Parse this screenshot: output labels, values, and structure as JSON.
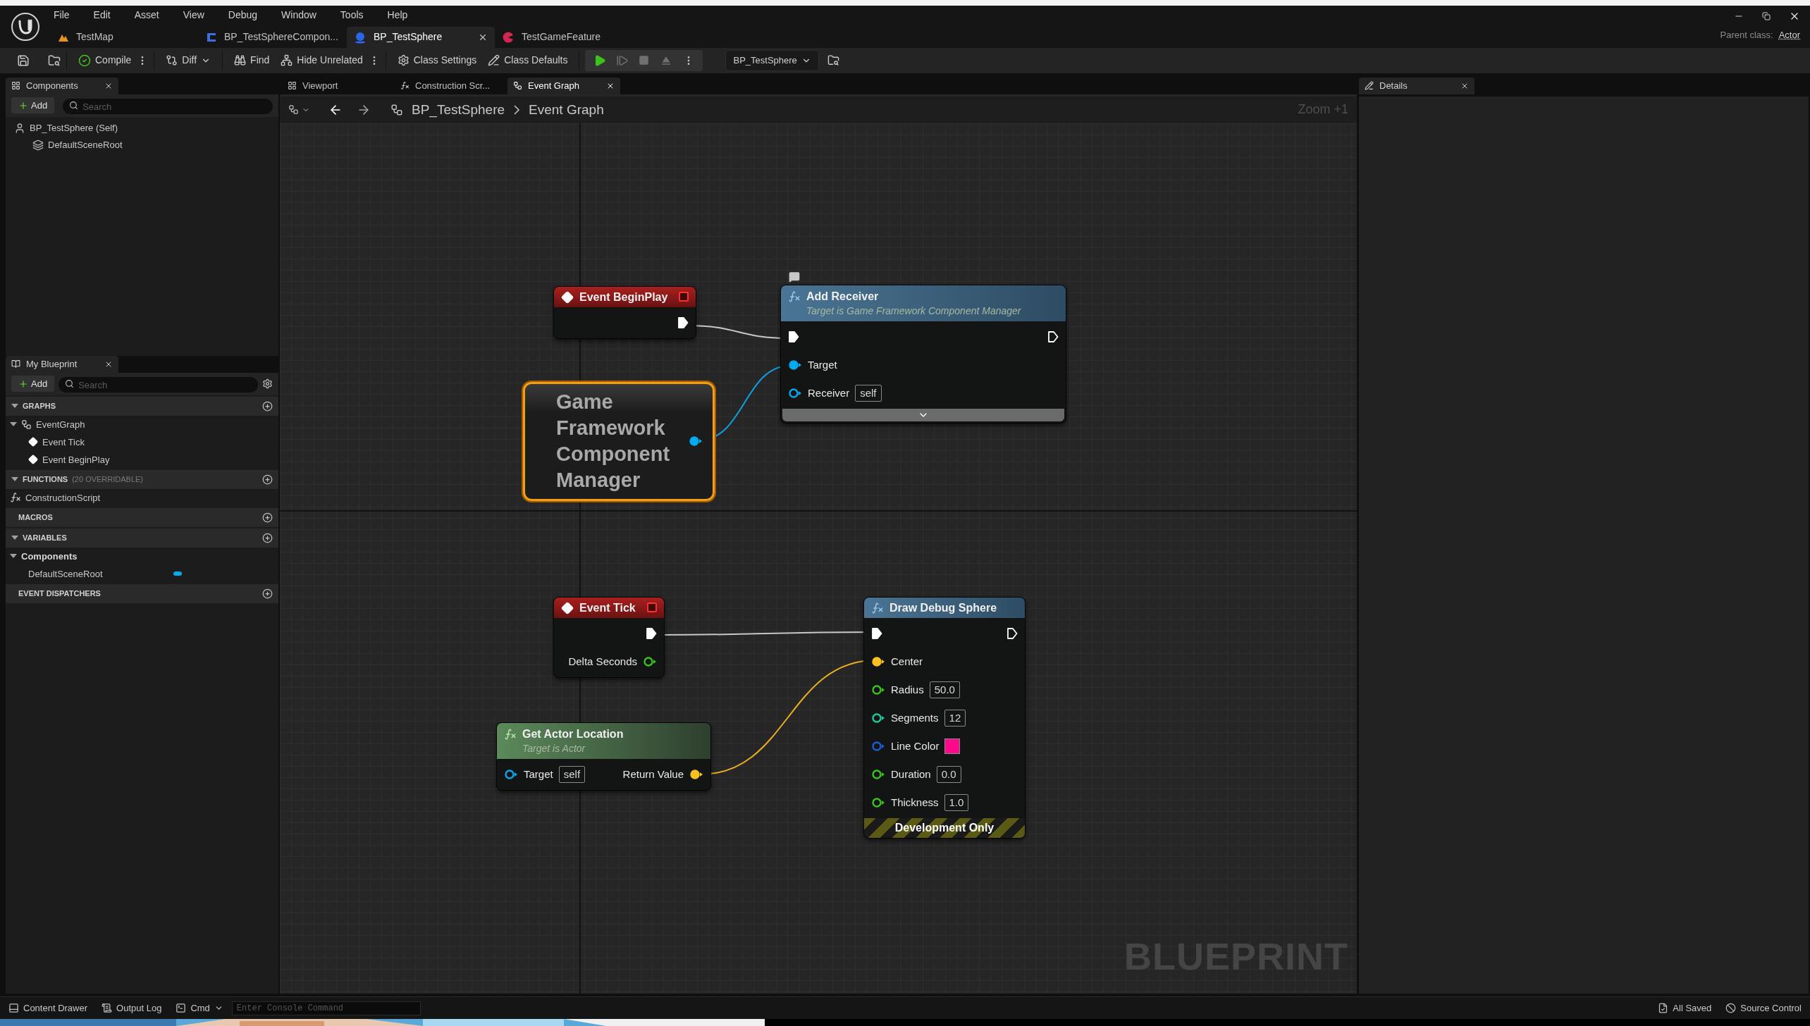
{
  "menu": [
    "File",
    "Edit",
    "Asset",
    "View",
    "Debug",
    "Window",
    "Tools",
    "Help"
  ],
  "document_tabs": [
    {
      "label": "TestMap",
      "kind": "level",
      "selected": false
    },
    {
      "label": "BP_TestSphereCompon...",
      "kind": "class",
      "selected": false
    },
    {
      "label": "BP_TestSphere",
      "kind": "blueprint",
      "selected": true
    },
    {
      "label": "TestGameFeature",
      "kind": "feature",
      "selected": false
    }
  ],
  "parent_class": {
    "label": "Parent class:",
    "value": "Actor"
  },
  "toolbar": {
    "buttons": [
      {
        "label": "Compile",
        "kind": "compile"
      },
      {
        "label": "Diff",
        "kind": "diff"
      },
      {
        "label": "Find",
        "kind": "find"
      },
      {
        "label": "Hide Unrelated",
        "kind": "hide"
      },
      {
        "label": "Class Settings",
        "kind": "settings"
      },
      {
        "label": "Class Defaults",
        "kind": "defaults"
      }
    ],
    "debug_object": "BP_TestSphere"
  },
  "components_panel": {
    "title": "Components",
    "add_label": "Add",
    "search_placeholder": "Search",
    "tree": [
      {
        "label": "BP_TestSphere (Self)",
        "kind": "actor",
        "children": [
          {
            "label": "DefaultSceneRoot",
            "kind": "scene"
          }
        ]
      }
    ]
  },
  "my_blueprint": {
    "title": "My Blueprint",
    "add_label": "Add",
    "search_placeholder": "Search",
    "sections": [
      {
        "title": "GRAPHS",
        "expanded": true,
        "items": [
          {
            "label": "EventGraph",
            "kind": "graph",
            "expanded": true,
            "children": [
              {
                "label": "Event Tick",
                "kind": "event"
              },
              {
                "label": "Event BeginPlay",
                "kind": "event"
              }
            ]
          }
        ]
      },
      {
        "title": "FUNCTIONS",
        "note": "(20 OVERRIDABLE)",
        "expanded": true,
        "items": [
          {
            "label": "ConstructionScript",
            "kind": "function"
          }
        ]
      },
      {
        "title": "MACROS"
      },
      {
        "title": "VARIABLES",
        "expanded": true,
        "items": [
          {
            "label": "Components",
            "kind": "category",
            "expanded": true,
            "children": [
              {
                "label": "DefaultSceneRoot",
                "kind": "variable",
                "color": "#00a8f0"
              }
            ]
          }
        ]
      },
      {
        "title": "EVENT DISPATCHERS"
      }
    ]
  },
  "graph_tabs": [
    {
      "label": "Viewport",
      "kind": "viewport",
      "selected": false
    },
    {
      "label": "Construction Scr...",
      "kind": "function",
      "selected": false
    },
    {
      "label": "Event Graph",
      "kind": "graph",
      "selected": true
    }
  ],
  "breadcrumb": [
    "BP_TestSphere",
    "Event Graph"
  ],
  "zoom": "Zoom +1",
  "nodes": [
    {
      "kind": "event",
      "title": "Event BeginPlay",
      "selected": false,
      "outputs": [
        {
          "kind": "exec",
          "connected": true
        }
      ]
    },
    {
      "kind": "function",
      "title": "Add Receiver",
      "subtitle": "Target is Game Framework Component Manager",
      "selected": false,
      "comment_bubble": true,
      "advanced_collapsed": true,
      "inputs": [
        {
          "kind": "exec",
          "connected": true
        },
        {
          "kind": "data",
          "label": "Target",
          "color": "#00a8f0",
          "connected": true
        },
        {
          "kind": "data",
          "label": "Receiver",
          "color": "#00a8f0",
          "connected": false,
          "value": "self"
        }
      ],
      "outputs": [
        {
          "kind": "exec",
          "connected": false
        }
      ]
    },
    {
      "kind": "variable",
      "title": "Game Framework Component Manager",
      "selected": true,
      "outputs": [
        {
          "kind": "data",
          "color": "#00a8f0",
          "connected": true
        }
      ]
    },
    {
      "kind": "event",
      "title": "Event Tick",
      "selected": false,
      "outputs": [
        {
          "kind": "exec",
          "connected": true
        },
        {
          "kind": "data",
          "label": "Delta Seconds",
          "color": "#3cc21c",
          "connected": false
        }
      ]
    },
    {
      "kind": "pure_function",
      "title": "Get Actor Location",
      "subtitle": "Target is Actor",
      "selected": false,
      "inputs": [
        {
          "kind": "data",
          "label": "Target",
          "color": "#00a8f0",
          "connected": false,
          "value": "self"
        }
      ],
      "outputs": [
        {
          "kind": "data",
          "label": "Return Value",
          "color": "#f8c020",
          "connected": true
        }
      ]
    },
    {
      "kind": "function",
      "title": "Draw Debug Sphere",
      "selected": false,
      "footer": "Development Only",
      "inputs": [
        {
          "kind": "exec",
          "connected": true
        },
        {
          "kind": "data",
          "label": "Center",
          "color": "#f8c020",
          "connected": true
        },
        {
          "kind": "data",
          "label": "Radius",
          "color": "#3cc21c",
          "connected": false,
          "value": "50.0"
        },
        {
          "kind": "data",
          "label": "Segments",
          "color": "#20c8a0",
          "connected": false,
          "value": "12"
        },
        {
          "kind": "data",
          "label": "Line Color",
          "color": "#1a5fd0",
          "connected": false,
          "swatch": {
            "color": "#ff0a8a"
          }
        },
        {
          "kind": "data",
          "label": "Duration",
          "color": "#3cc21c",
          "connected": false,
          "value": "0.0"
        },
        {
          "kind": "data",
          "label": "Thickness",
          "color": "#3cc21c",
          "connected": false,
          "value": "1.0"
        }
      ],
      "outputs": [
        {
          "kind": "exec",
          "connected": false
        }
      ]
    }
  ],
  "graph_label": "BLUEPRINT",
  "details_panel": {
    "title": "Details"
  },
  "status_bar": {
    "left": [
      {
        "label": "Content Drawer",
        "kind": "drawer"
      },
      {
        "label": "Output Log",
        "kind": "log"
      },
      {
        "label": "Cmd",
        "kind": "cmd"
      }
    ],
    "console_placeholder": "Enter Console Command",
    "right": [
      {
        "label": "All Saved",
        "kind": "saved"
      },
      {
        "label": "Source Control",
        "kind": "source"
      }
    ]
  }
}
